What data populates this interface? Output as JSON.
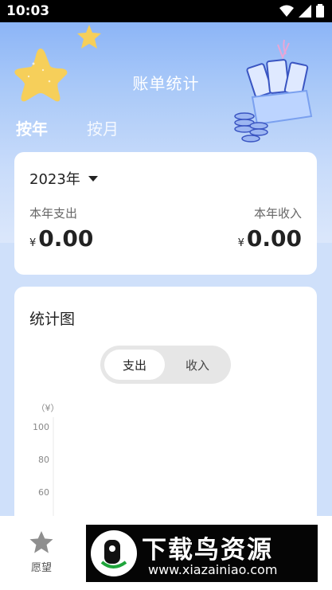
{
  "status_bar": {
    "time": "10:03"
  },
  "header": {
    "title": "账单统计"
  },
  "tabs": [
    {
      "label": "按年",
      "active": true
    },
    {
      "label": "按月",
      "active": false
    }
  ],
  "summary": {
    "year": "2023年",
    "expense_label": "本年支出",
    "income_label": "本年收入",
    "currency": "¥",
    "expense_amount": "0.00",
    "income_amount": "0.00"
  },
  "chart_section": {
    "title": "统计图",
    "toggle": {
      "expense": "支出",
      "income": "收入",
      "selected": "支出"
    }
  },
  "chart_data": {
    "type": "bar",
    "ylabel": "（¥）",
    "yticks": [
      100,
      80,
      60
    ],
    "categories": [],
    "values": []
  },
  "bottom_nav": {
    "items": [
      {
        "label": "愿望",
        "icon": "star-icon"
      }
    ]
  },
  "watermark": {
    "title": "下载鸟资源",
    "url": "www.xiazainiao.com"
  },
  "colors": {
    "header_gradient_top": "#82aef6",
    "star": "#f6cf5a",
    "card": "#ffffff",
    "toggle_bg": "#e6e6e6"
  }
}
